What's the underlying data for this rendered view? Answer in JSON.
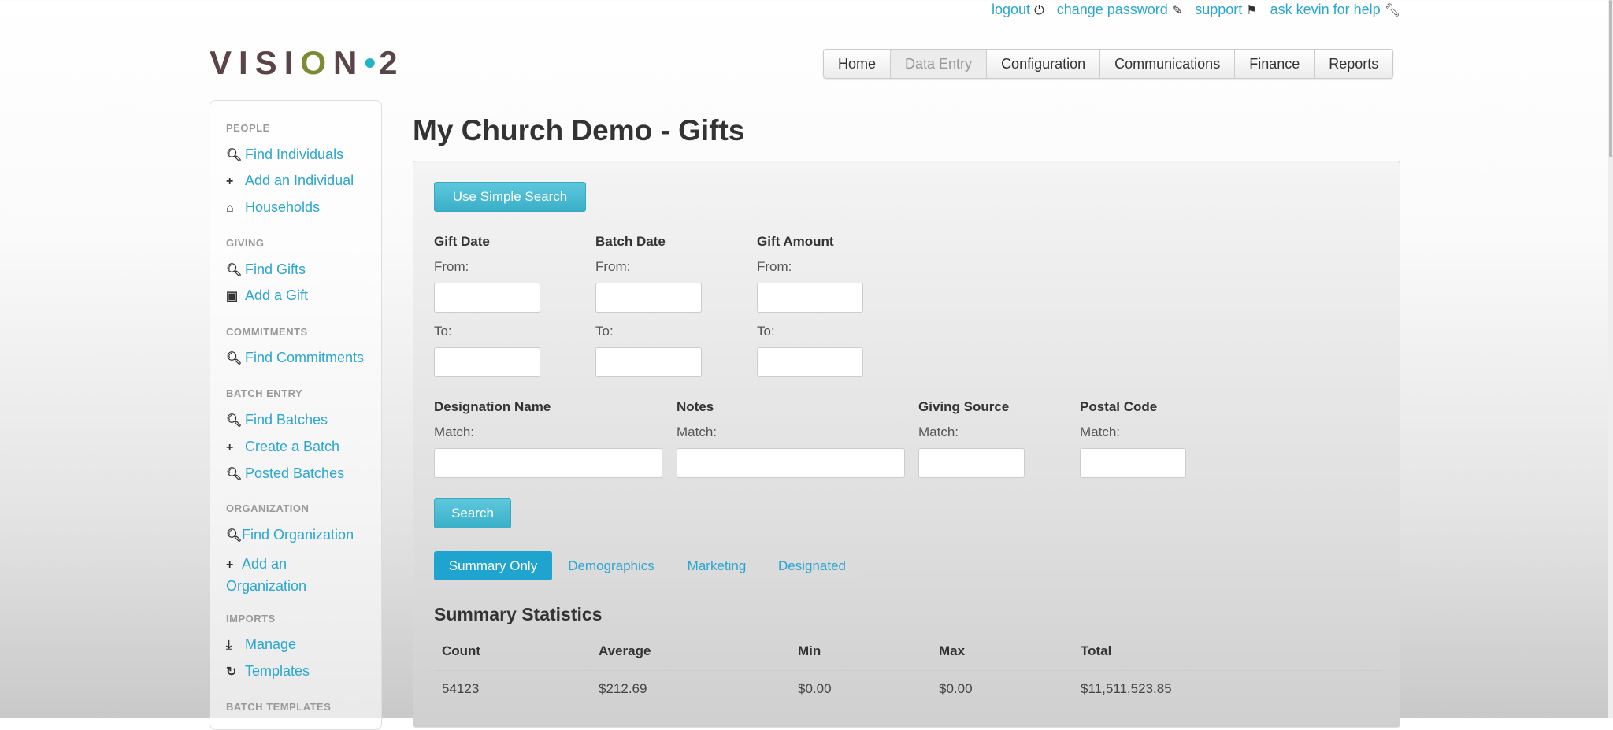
{
  "top_links": [
    {
      "label": "logout",
      "icon": "power-icon"
    },
    {
      "label": "change password",
      "icon": "edit-icon"
    },
    {
      "label": "support",
      "icon": "flag-icon"
    },
    {
      "label": "ask kevin for help",
      "icon": "wrench-icon"
    }
  ],
  "logo": {
    "text": "VISION·2",
    "part1": "VISI",
    "o": "O",
    "part2": "N",
    "dot": "•",
    "part3": "2"
  },
  "nav": [
    "Home",
    "Data Entry",
    "Configuration",
    "Communications",
    "Finance",
    "Reports"
  ],
  "sidebar": {
    "people": "PEOPLE",
    "find_individuals": "Find Individuals",
    "add_individual": "Add an Individual",
    "households": "Households",
    "giving": "GIVING",
    "find_gifts": "Find Gifts",
    "add_gift": "Add a Gift",
    "commitments": "COMMITMENTS",
    "find_commitments": "Find Commitments",
    "batch_entry": "BATCH ENTRY",
    "find_batches": "Find Batches",
    "create_batch": "Create a Batch",
    "posted_batches": "Posted Batches",
    "organization": "ORGANIZATION",
    "find_organization": "Find Organization",
    "add_organization_1": "Add an",
    "add_organization_2": "Organization",
    "imports": "IMPORTS",
    "manage": "Manage",
    "templates": "Templates",
    "batch_templates": "BATCH TEMPLATES"
  },
  "page_title": "My Church Demo - Gifts",
  "form": {
    "simple_search": "Use Simple Search",
    "gift_date": "Gift Date",
    "batch_date": "Batch Date",
    "gift_amount": "Gift Amount",
    "from": "From:",
    "to": "To:",
    "designation_name": "Designation Name",
    "notes": "Notes",
    "giving_source": "Giving Source",
    "postal_code": "Postal Code",
    "match": "Match:",
    "search": "Search"
  },
  "tabs": [
    "Summary Only",
    "Demographics",
    "Marketing",
    "Designated"
  ],
  "summary": {
    "title": "Summary Statistics",
    "headers": [
      "Count",
      "Average",
      "Min",
      "Max",
      "Total"
    ],
    "row": [
      "54123",
      "$212.69",
      "$0.00",
      "$0.00",
      "$11,511,523.85"
    ]
  }
}
